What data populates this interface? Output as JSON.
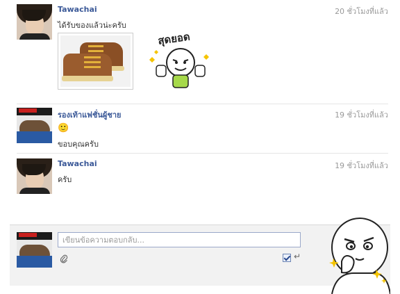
{
  "messages": [
    {
      "sender": "Tawachai",
      "time": "20 ชั่วโมงที่แล้ว",
      "text": "ได้รับของแล้วน่ะครับ",
      "sticker_text": "สุดยอด"
    },
    {
      "sender": "รองเท้าแฟชั่นผู้ชาย",
      "time": "19 ชั่วโมงที่แล้ว",
      "emoji": "🙂",
      "text": "ขอบคุณครับ"
    },
    {
      "sender": "Tawachai",
      "time": "19 ชั่วโมงที่แล้ว",
      "text": "ครับ"
    }
  ],
  "reply": {
    "placeholder": "เขียนข้อความตอบกลับ...",
    "enter_to_send_checked": true,
    "enter_icon": "↵"
  },
  "icons": {
    "attach": "paperclip-icon",
    "enter": "enter-key-icon"
  },
  "colors": {
    "name_link": "#3b5998",
    "timestamp": "#999999",
    "reply_bg": "#f2f2f2"
  }
}
